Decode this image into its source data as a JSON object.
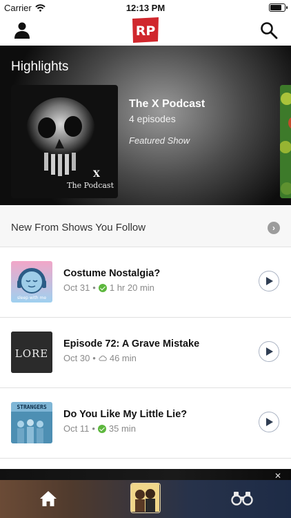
{
  "status_bar": {
    "carrier": "Carrier",
    "time": "12:13 PM"
  },
  "nav": {
    "logo_text": "RP",
    "profile_icon": "person-icon",
    "search_icon": "magnifier-icon"
  },
  "highlights": {
    "title": "Highlights",
    "featured": {
      "art_title": "X",
      "art_subtitle": "The Podcast",
      "show_title": "The X Podcast",
      "episodes": "4 episodes",
      "tag": "Featured Show"
    }
  },
  "new_from_follows": {
    "title": "New From Shows You Follow",
    "chevron": "›"
  },
  "episodes": [
    {
      "title": "Costume Nostalgia?",
      "date": "Oct 31",
      "duration": "1 hr 20 min",
      "status": "downloaded",
      "art_label": "sleep with me"
    },
    {
      "title": "Episode 72: A Grave Mistake",
      "date": "Oct 30",
      "duration": "46 min",
      "status": "cloud",
      "art_label": "LORE"
    },
    {
      "title": "Do You Like My Little Lie?",
      "date": "Oct 11",
      "duration": "35 min",
      "status": "downloaded",
      "art_label": "STRANGERS"
    }
  ],
  "separator": "•",
  "mini_player": {
    "close_glyph": "✕"
  },
  "tab_bar": {
    "home_icon": "house-icon",
    "discover_icon": "binoculars-icon"
  },
  "colors": {
    "brand_red": "#d0272d",
    "download_green": "#5db73e",
    "play_navy": "#2f3d52"
  }
}
